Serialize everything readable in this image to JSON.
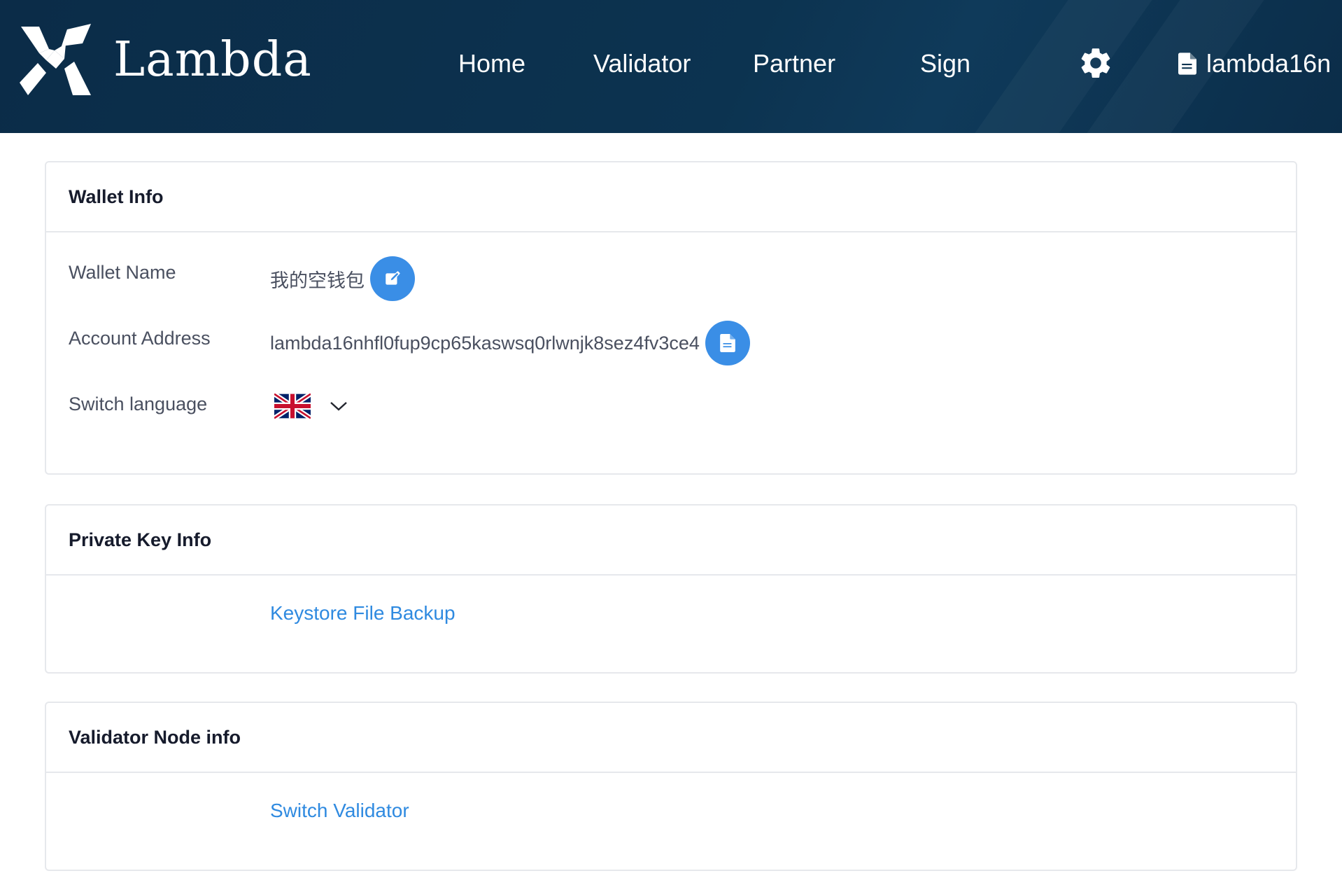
{
  "header": {
    "brand": "Lambda",
    "nav": [
      "Home",
      "Validator",
      "Partner",
      "Sign"
    ],
    "account_label": "lambda16n"
  },
  "wallet_info": {
    "title": "Wallet Info",
    "wallet_name_label": "Wallet Name",
    "wallet_name_value": "我的空钱包",
    "account_address_label": "Account Address",
    "account_address_value": "lambda16nhfl0fup9cp65kaswsq0rlwnjk8sez4fv3ce4",
    "switch_language_label": "Switch language",
    "language_flag": "uk-flag-icon"
  },
  "private_key_info": {
    "title": "Private Key Info",
    "backup_link": "Keystore File Backup"
  },
  "validator_node_info": {
    "title": "Validator Node info",
    "switch_link": "Switch Validator"
  },
  "colors": {
    "header_bg": "#0c3350",
    "accent": "#3a8ee6",
    "link": "#2f8ae0"
  }
}
